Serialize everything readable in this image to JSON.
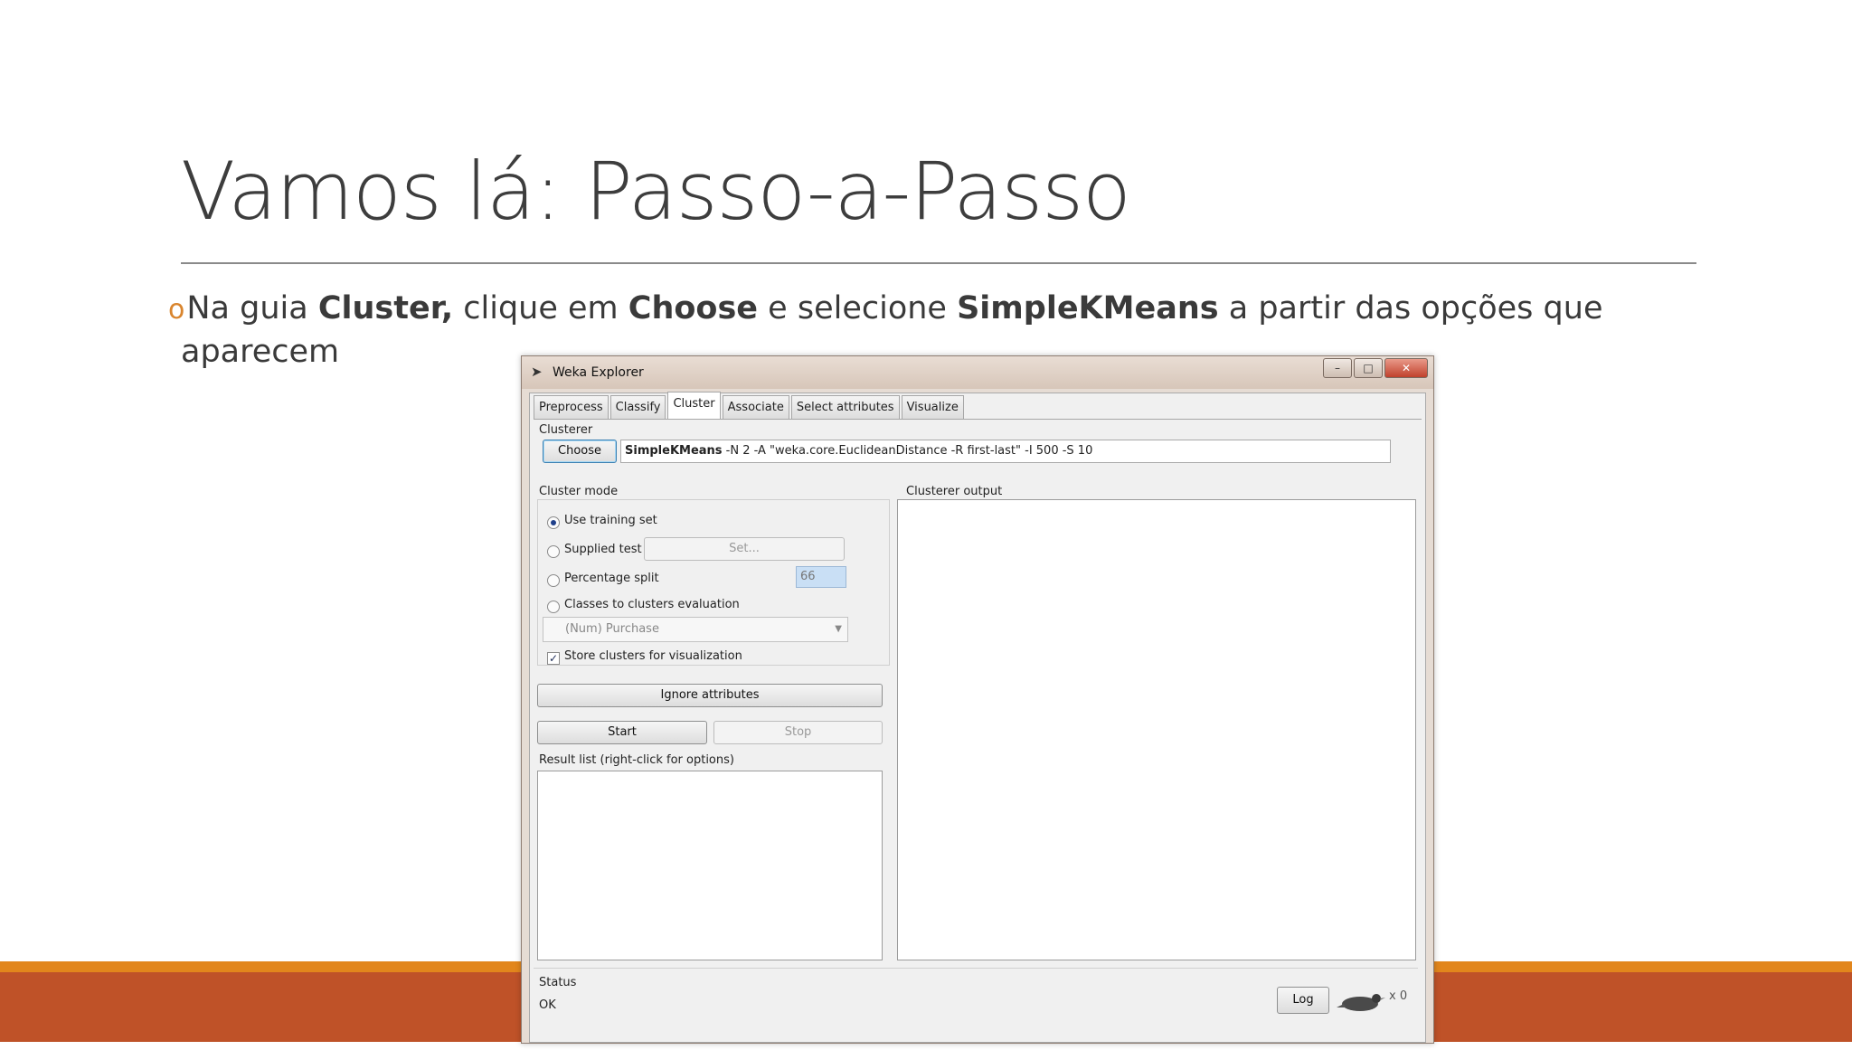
{
  "slide": {
    "title": "Vamos lá: Passo-a-Passo",
    "bullet": {
      "marker": "o",
      "t1": "Na guia ",
      "b1": "Cluster,",
      "t2": " clique em ",
      "b2": "Choose",
      "t3": " e selecione ",
      "b3": "SimpleKMeans",
      "t4": " a partir das opções que",
      "t5": "aparecem"
    }
  },
  "window": {
    "title": "Weka Explorer",
    "tabs": [
      "Preprocess",
      "Classify",
      "Cluster",
      "Associate",
      "Select attributes",
      "Visualize"
    ],
    "active_tab": "Cluster",
    "clusterer": {
      "label": "Clusterer",
      "choose_label": "Choose",
      "name": "SimpleKMeans",
      "options": " -N 2 -A \"weka.core.EuclideanDistance -R first-last\" -I 500 -S 10"
    },
    "cluster_mode": {
      "label": "Cluster mode",
      "use_training": "Use training set",
      "supplied_test": "Supplied test set",
      "set_label": "Set...",
      "percentage_split": "Percentage split",
      "percent_sign": "%",
      "percent_value": "66",
      "classes_eval": "Classes to clusters evaluation",
      "class_select": "(Num) Purchase",
      "store_clusters": "Store clusters for visualization",
      "selected": "Use training set",
      "store_checked": true
    },
    "ignore_label": "Ignore attributes",
    "start_label": "Start",
    "stop_label": "Stop",
    "result_list_label": "Result list (right-click for options)",
    "output_label": "Clusterer output",
    "status": {
      "label": "Status",
      "value": "OK",
      "log_label": "Log",
      "count": "x 0"
    },
    "colors": {
      "footer_orange": "#e2861c",
      "footer_rust": "#bf5228",
      "bullet_marker": "#d9852e"
    }
  }
}
